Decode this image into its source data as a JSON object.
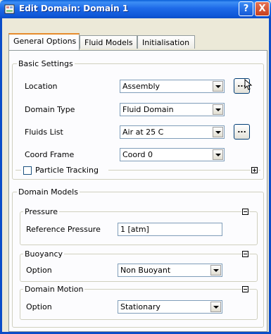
{
  "window": {
    "title": "Edit Domain: Domain 1",
    "help_label": "?",
    "close_label": "X"
  },
  "tabs": [
    {
      "label": "General Options"
    },
    {
      "label": "Fluid Models"
    },
    {
      "label": "Initialisation"
    }
  ],
  "basic_settings": {
    "title": "Basic Settings",
    "location": {
      "label": "Location",
      "value": "Assembly"
    },
    "domain_type": {
      "label": "Domain Type",
      "value": "Fluid Domain"
    },
    "fluids_list": {
      "label": "Fluids List",
      "value": "Air at 25 C"
    },
    "coord_frame": {
      "label": "Coord Frame",
      "value": "Coord 0"
    },
    "particle_tracking": {
      "label": "Particle Tracking",
      "checked": false
    },
    "ellipsis_label": "..."
  },
  "domain_models": {
    "title": "Domain Models",
    "pressure": {
      "title": "Pressure",
      "reference_label": "Reference Pressure",
      "reference_value": "1 [atm]"
    },
    "buoyancy": {
      "title": "Buoyancy",
      "option_label": "Option",
      "option_value": "Non Buoyant"
    },
    "domain_motion": {
      "title": "Domain Motion",
      "option_label": "Option",
      "option_value": "Stationary"
    }
  }
}
